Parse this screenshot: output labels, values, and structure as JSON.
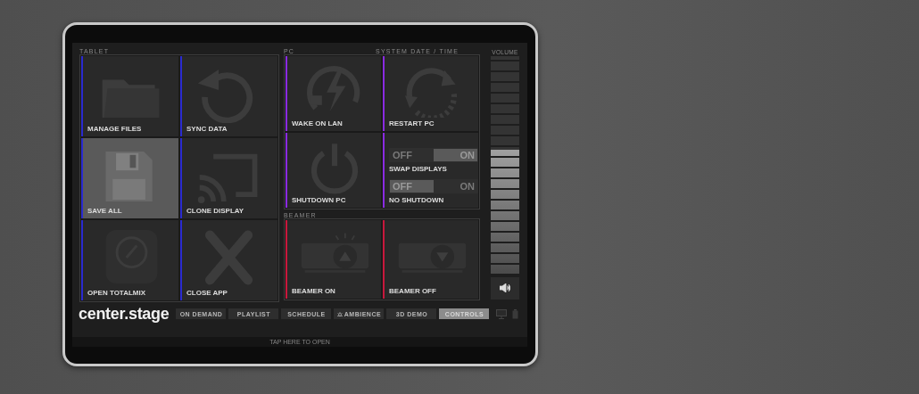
{
  "panels": [
    {
      "title": "TABLET",
      "color": "#2b2bd0",
      "tiles": [
        {
          "kind": "folder",
          "label": "MANAGE FILES",
          "selected": false
        },
        {
          "kind": "sync",
          "label": "SYNC DATA",
          "selected": false
        },
        {
          "kind": "save",
          "label": "SAVE ALL",
          "selected": true
        },
        {
          "kind": "cast",
          "label": "CLONE DISPLAY",
          "selected": false
        },
        {
          "kind": "dial",
          "label": "OPEN TOTALMIX",
          "selected": false
        },
        {
          "kind": "close",
          "label": "CLOSE APP",
          "selected": false
        }
      ]
    },
    {
      "title": "PC",
      "extra": "SYSTEM DATE / TIME",
      "color": "#8a2be2",
      "tiles": [
        {
          "kind": "wake",
          "label": "WAKE ON LAN",
          "selected": false
        },
        {
          "kind": "restart",
          "label": "RESTART PC",
          "selected": false
        },
        {
          "kind": "power",
          "label": "SHUTDOWN PC",
          "selected": false
        }
      ],
      "toggle_card": {
        "kind": "toggles",
        "toggles": [
          {
            "off_label": "OFF",
            "on_label": "ON",
            "on": true,
            "label": "SWAP DISPLAYS"
          },
          {
            "off_label": "OFF",
            "on_label": "ON",
            "on": false,
            "label": "NO SHUTDOWN"
          }
        ]
      }
    },
    {
      "title": "BEAMER",
      "color": "#c8183c",
      "tiles": [
        {
          "kind": "beamer-up",
          "label": "BEAMER ON",
          "selected": false
        },
        {
          "kind": "beamer-down",
          "label": "BEAMER OFF",
          "selected": false
        }
      ]
    }
  ],
  "volume": {
    "title": "VOLUME",
    "level": 0.57
  },
  "logo": "center.stage",
  "tabs": [
    {
      "kind": "plain",
      "label": "ON DEMAND",
      "selected": false
    },
    {
      "kind": "plain",
      "label": "PLAYLIST",
      "selected": false
    },
    {
      "kind": "plain",
      "label": "SCHEDULE",
      "selected": false
    },
    {
      "kind": "with-icon",
      "label": "AMBIENCE",
      "selected": false
    },
    {
      "kind": "plain",
      "label": "3D DEMO",
      "selected": false
    },
    {
      "kind": "plain",
      "label": "CONTROLS",
      "selected": true
    }
  ],
  "status_bar": "TAP HERE TO OPEN"
}
